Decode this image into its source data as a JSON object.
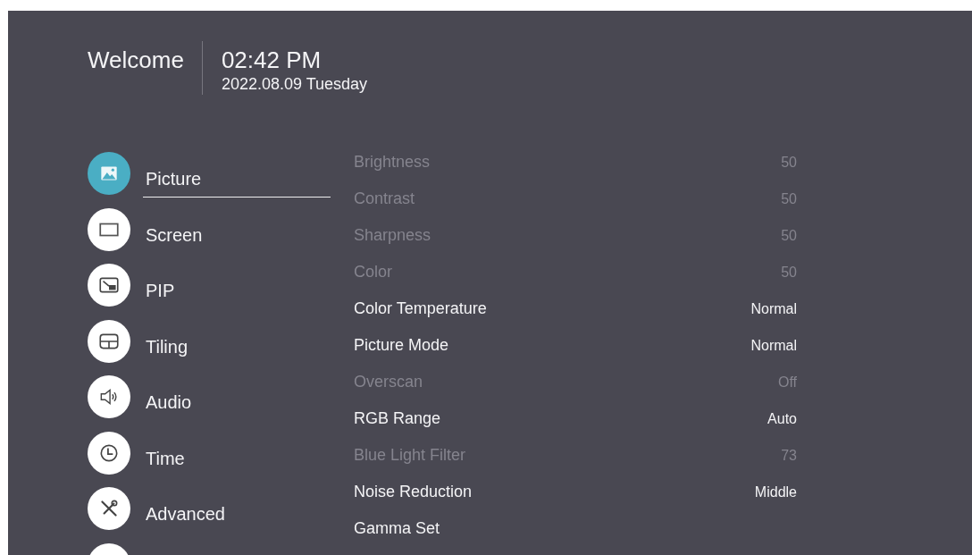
{
  "header": {
    "greeting": "Welcome",
    "time": "02:42 PM",
    "date": "2022.08.09 Tuesday"
  },
  "sidebar": {
    "items": [
      {
        "label": "Picture",
        "selected": true
      },
      {
        "label": "Screen",
        "selected": false
      },
      {
        "label": "PIP",
        "selected": false
      },
      {
        "label": "Tiling",
        "selected": false
      },
      {
        "label": "Audio",
        "selected": false
      },
      {
        "label": "Time",
        "selected": false
      },
      {
        "label": "Advanced",
        "selected": false
      },
      {
        "selected": false
      }
    ]
  },
  "settings": [
    {
      "label": "Brightness",
      "value": "50",
      "disabled": true
    },
    {
      "label": "Contrast",
      "value": "50",
      "disabled": true
    },
    {
      "label": "Sharpness",
      "value": "50",
      "disabled": true
    },
    {
      "label": "Color",
      "value": "50",
      "disabled": true
    },
    {
      "label": "Color Temperature",
      "value": "Normal",
      "disabled": false
    },
    {
      "label": "Picture Mode",
      "value": "Normal",
      "disabled": false
    },
    {
      "label": "Overscan",
      "value": "Off",
      "disabled": true
    },
    {
      "label": "RGB Range",
      "value": "Auto",
      "disabled": false
    },
    {
      "label": "Blue Light Filter",
      "value": "73",
      "disabled": true
    },
    {
      "label": "Noise Reduction",
      "value": "Middle",
      "disabled": false
    },
    {
      "label": "Gamma Set",
      "disabled": false
    }
  ]
}
